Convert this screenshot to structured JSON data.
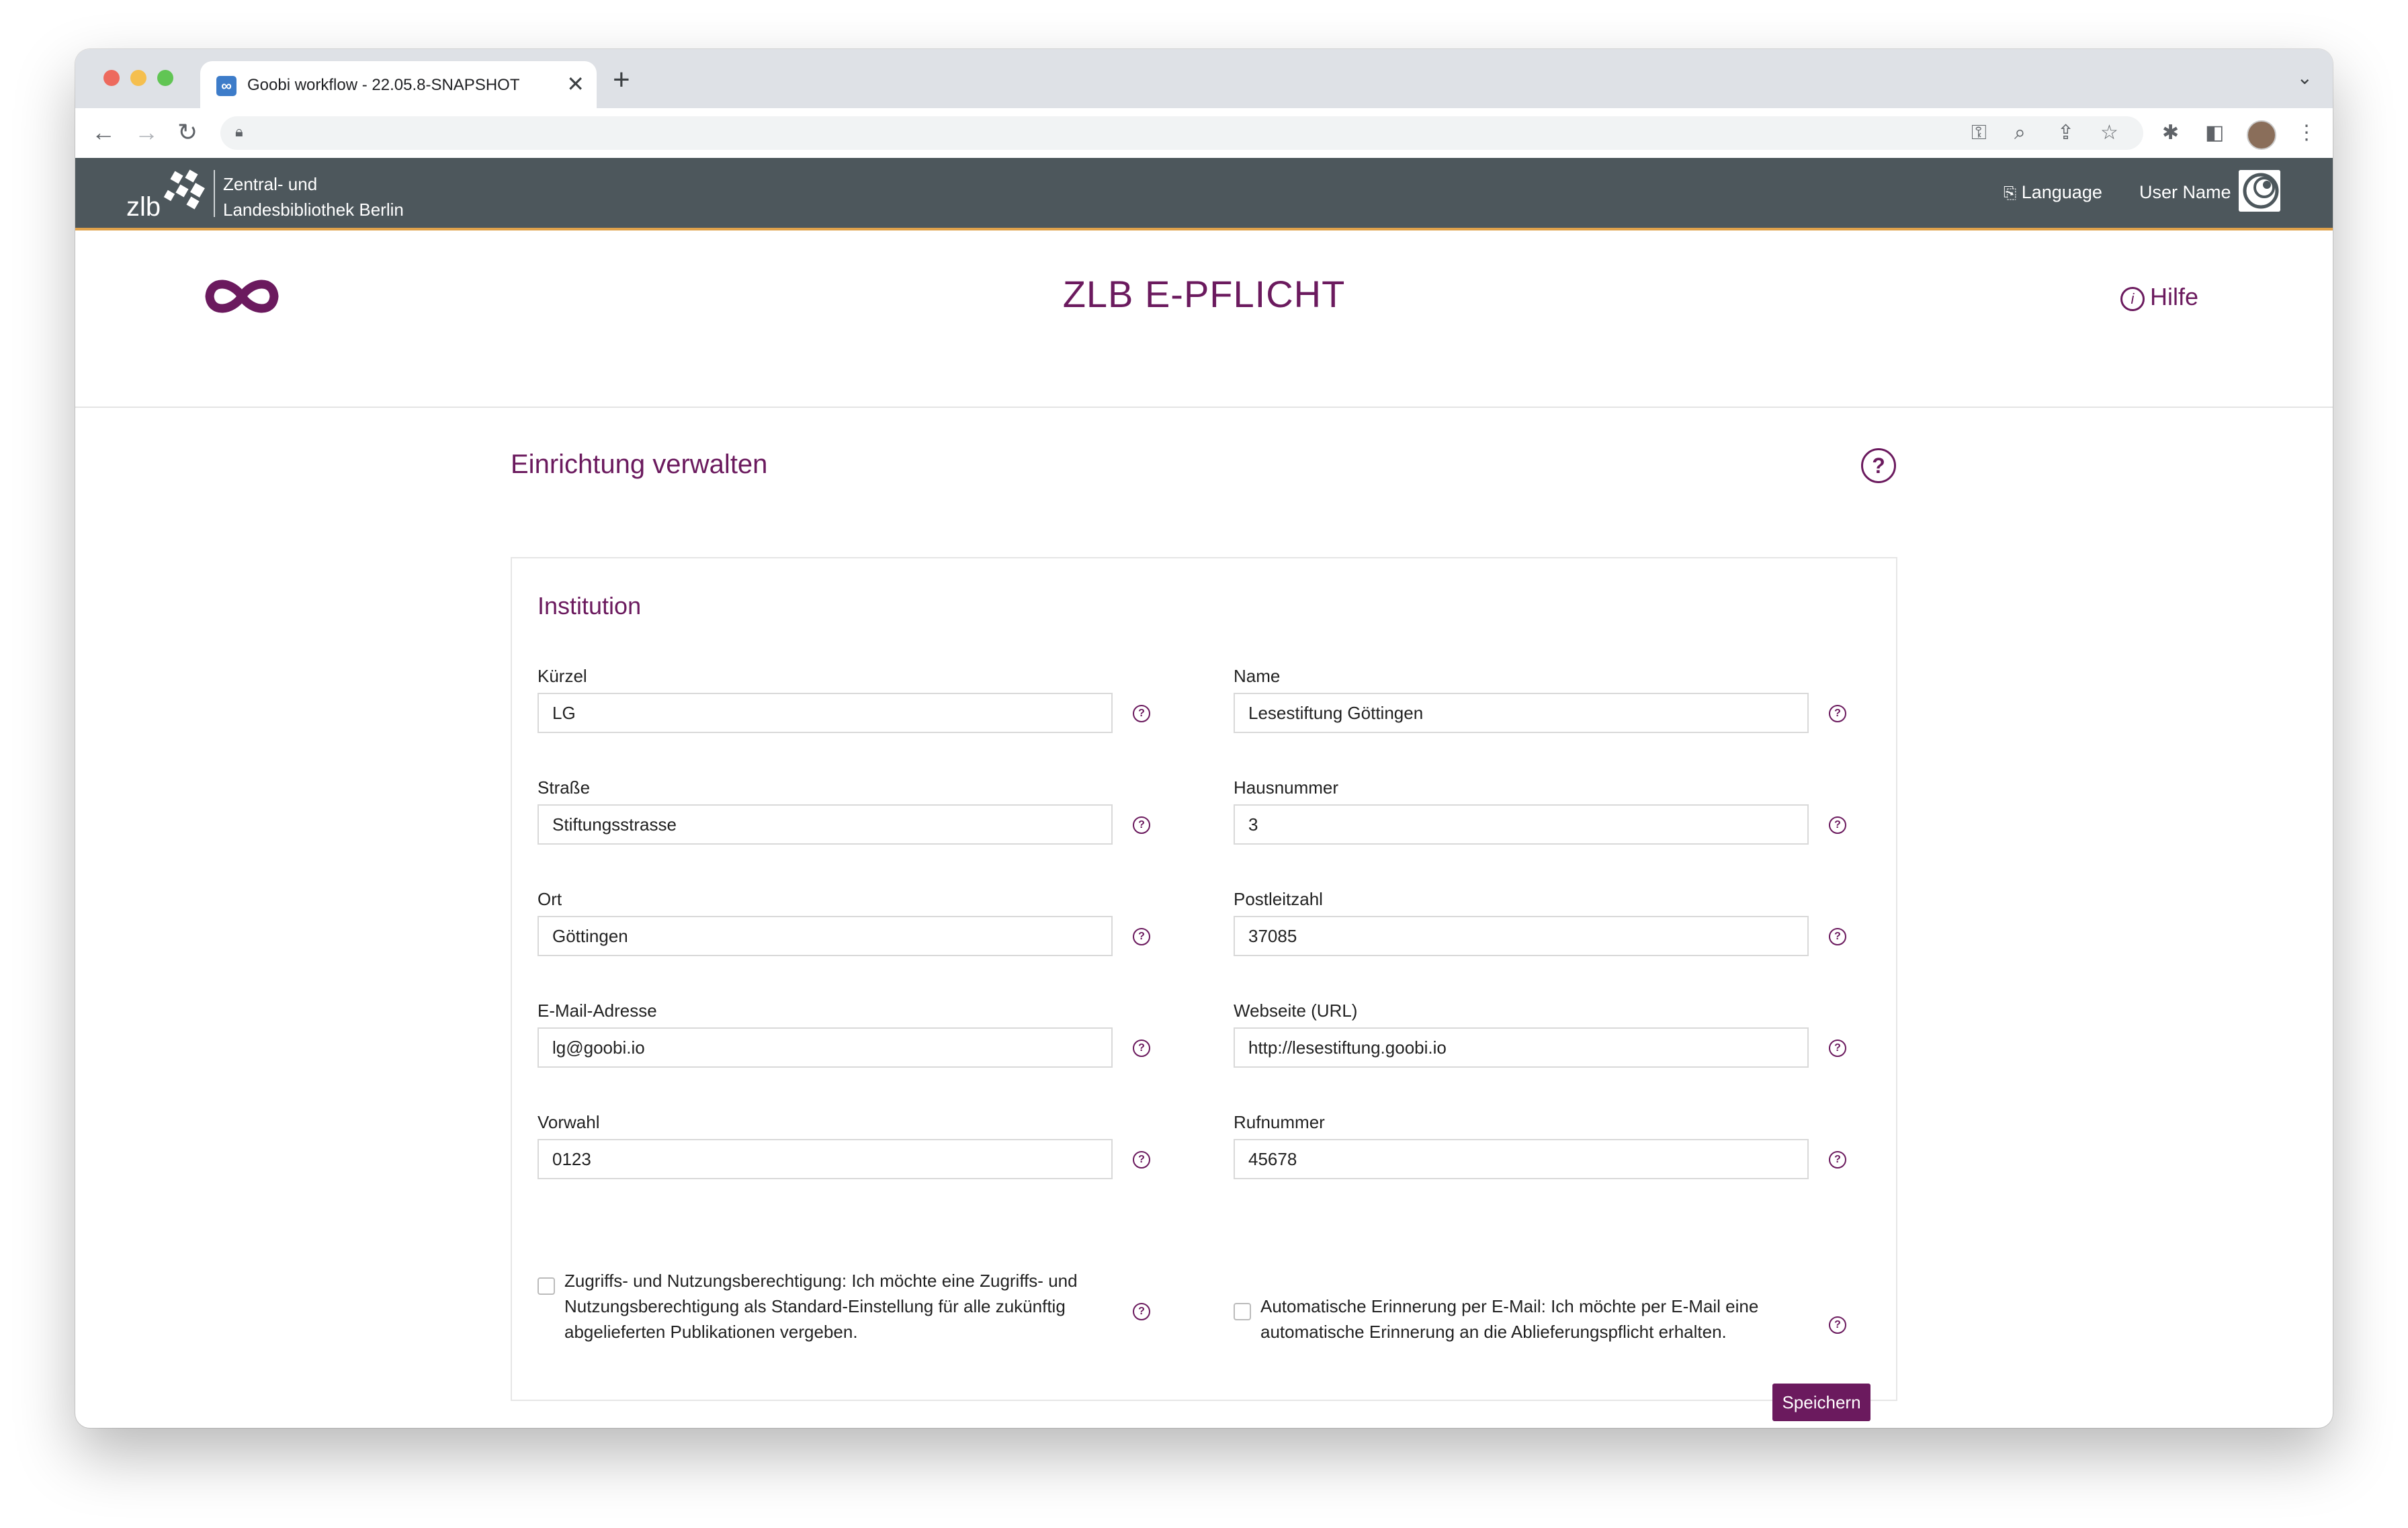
{
  "browser": {
    "tab_title": "Goobi workflow - 22.05.8-SNAPSHOT",
    "tab_favicon": "∞",
    "new_tab_symbol": "+",
    "close_symbol": "✕"
  },
  "appbar": {
    "logo_text": "zlb",
    "institution_line1": "Zentral- und",
    "institution_line2": "Landesbibliothek Berlin",
    "language_label": "Language",
    "user_label": "User Name"
  },
  "pagehead": {
    "title": "ZLB E-PFLICHT",
    "help_label": "Hilfe"
  },
  "content": {
    "section_title": "Einrichtung verwalten",
    "card_title": "Institution",
    "fields": [
      {
        "label": "Kürzel",
        "value": "LG"
      },
      {
        "label": "Name",
        "value": "Lesestiftung Göttingen"
      },
      {
        "label": "Straße",
        "value": "Stiftungsstrasse"
      },
      {
        "label": "Hausnummer",
        "value": "3"
      },
      {
        "label": "Ort",
        "value": "Göttingen"
      },
      {
        "label": "Postleitzahl",
        "value": "37085"
      },
      {
        "label": "E-Mail-Adresse",
        "value": "lg@goobi.io"
      },
      {
        "label": "Webseite (URL)",
        "value": "http://lesestiftung.goobi.io"
      },
      {
        "label": "Vorwahl",
        "value": "0123"
      },
      {
        "label": "Rufnummer",
        "value": "45678"
      }
    ],
    "checkbox_access_line1": "Zugriffs- und Nutzungsberechtigung: Ich möchte eine Zugriffs- und",
    "checkbox_access_line2": "Nutzungsberechtigung als Standard-Einstellung für alle zukünftig",
    "checkbox_access_line3": "abgelieferten Publikationen vergeben.",
    "checkbox_reminder_line1": "Automatische Erinnerung per E-Mail: Ich möchte per E-Mail eine",
    "checkbox_reminder_line2": "automatische Erinnerung an die Ablieferungspflicht erhalten.",
    "save_label": "Speichern"
  },
  "colors": {
    "accent": "#6b1a5e",
    "appbar": "#4d575c",
    "appbar_border": "#e0a24b"
  }
}
